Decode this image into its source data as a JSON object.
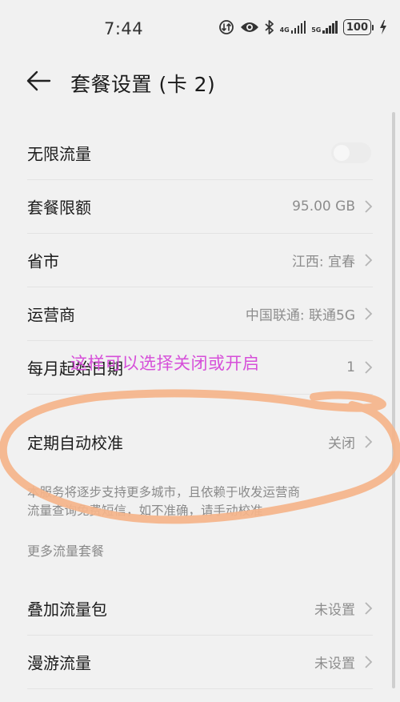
{
  "status_bar": {
    "time": "7:44",
    "signal1_label": "4G",
    "signal2_label": "5G",
    "battery": "100",
    "icons": [
      "data-saver-icon",
      "eye-icon",
      "bluetooth-icon",
      "signal-icon",
      "signal-icon",
      "battery-icon",
      "charging-icon"
    ]
  },
  "header": {
    "title": "套餐设置 (卡 2)",
    "back_icon": "arrow-left-icon"
  },
  "settings": {
    "unlimited": {
      "label": "无限流量",
      "enabled": false
    },
    "quota": {
      "label": "套餐限额",
      "value": "95.00 GB"
    },
    "province": {
      "label": "省市",
      "value": "江西: 宜春"
    },
    "carrier": {
      "label": "运营商",
      "value": "中国联通: 联通5G"
    },
    "start_date": {
      "label": "每月起始日期",
      "value": "1"
    },
    "auto_calibrate": {
      "label": "定期自动校准",
      "value": "关闭"
    }
  },
  "note": {
    "line1": "本服务将逐步支持更多城市，且依赖于收发运营商",
    "line2": "流量查询免费短信，如不准确，请手动校准"
  },
  "more_section": {
    "title": "更多流量套餐",
    "addon": {
      "label": "叠加流量包",
      "value": "未设置"
    },
    "roaming": {
      "label": "漫游流量",
      "value": "未设置"
    }
  },
  "annotation": {
    "text": "这样可以选择关闭或开启",
    "text_color": "#d64fd9",
    "stroke_color": "#f5b48a"
  }
}
